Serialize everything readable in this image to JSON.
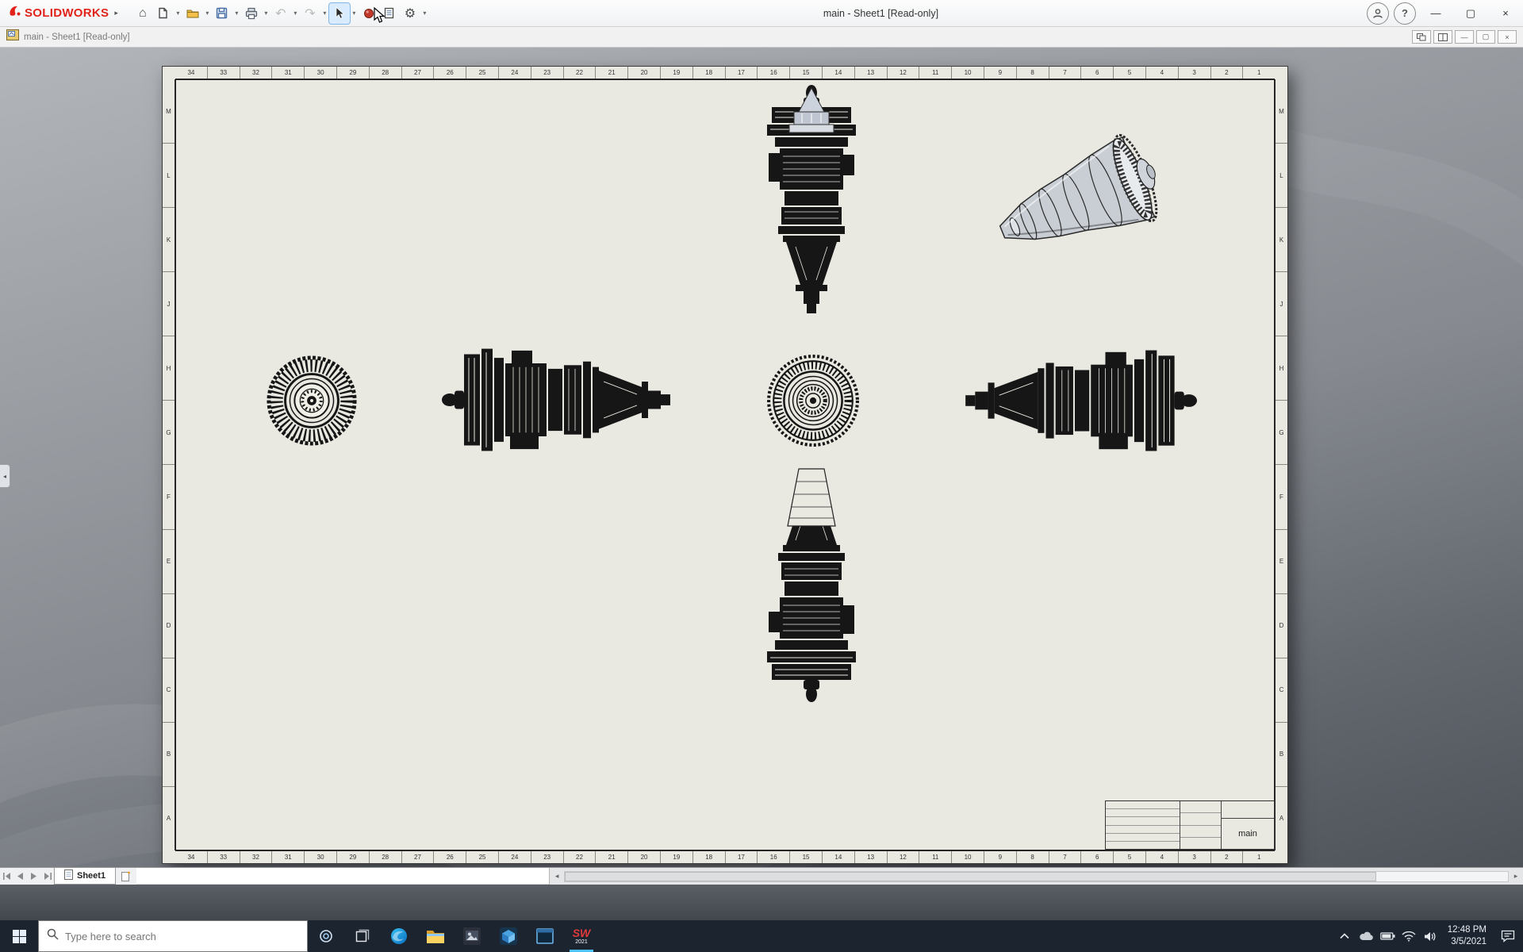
{
  "titlebar": {
    "brand": "SOLIDWORKS",
    "title": "main - Sheet1 [Read-only]"
  },
  "docbar": {
    "title": "main - Sheet1 [Read-only]"
  },
  "icons": {
    "dropdown": "▾",
    "home": "⌂",
    "undo": "↶",
    "redo": "↷",
    "gear": "⚙",
    "help": "?",
    "minimize": "—",
    "maximize": "▢",
    "close": "×",
    "doc_minimize": "—",
    "doc_restore": "▢",
    "doc_close": "×",
    "scroll_left": "◂",
    "scroll_right": "▸",
    "pane_collapse": "◂"
  },
  "sheet": {
    "zone_numbers": [
      "34",
      "33",
      "32",
      "31",
      "30",
      "29",
      "28",
      "27",
      "26",
      "25",
      "24",
      "23",
      "22",
      "21",
      "20",
      "19",
      "18",
      "17",
      "16",
      "15",
      "14",
      "13",
      "12",
      "11",
      "10",
      "9",
      "8",
      "7",
      "6",
      "5",
      "4",
      "3",
      "2",
      "1"
    ],
    "zone_letters": [
      "M",
      "L",
      "K",
      "J",
      "H",
      "G",
      "F",
      "E",
      "D",
      "C",
      "B",
      "A"
    ],
    "title_block_name": "main"
  },
  "tabbar": {
    "sheet_tab": "Sheet1"
  },
  "taskbar": {
    "search_placeholder": "Type here to search",
    "sw_label": "SW",
    "sw_year": "2021",
    "time": "12:48 PM",
    "date": "3/5/2021"
  }
}
